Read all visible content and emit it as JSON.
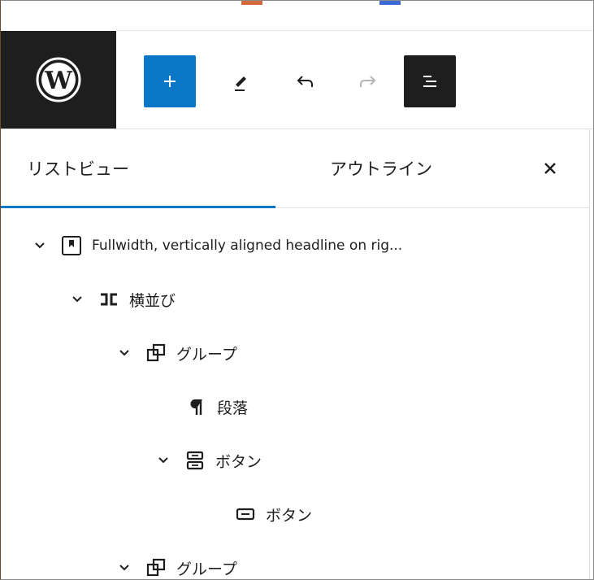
{
  "toolbar": {
    "logo": "wordpress-logo",
    "buttons": [
      "add-block",
      "tools-pen",
      "undo",
      "redo",
      "document-overview"
    ],
    "colors": {
      "accent": "#0a78c7",
      "dark": "#1e1e1e"
    }
  },
  "panel": {
    "tabs": [
      {
        "label": "リストビュー",
        "selected": true
      },
      {
        "label": "アウトライン",
        "selected": false
      }
    ],
    "close_label": "✕"
  },
  "tree": [
    {
      "label": "Fullwidth, vertically aligned headline on rig...",
      "icon": "pattern-icon",
      "level": 0,
      "expanded": true
    },
    {
      "label": "横並び",
      "icon": "columns-icon",
      "level": 1,
      "expanded": true
    },
    {
      "label": "グループ",
      "icon": "group-icon",
      "level": 2,
      "expanded": true
    },
    {
      "label": "段落",
      "icon": "paragraph-icon",
      "level": 3,
      "expanded": null
    },
    {
      "label": "ボタン",
      "icon": "buttons-icon",
      "level": 3,
      "expanded": true
    },
    {
      "label": "ボタン",
      "icon": "button-icon",
      "level": 4,
      "expanded": null
    },
    {
      "label": "グループ",
      "icon": "group-icon",
      "level": 2,
      "expanded": true
    }
  ]
}
